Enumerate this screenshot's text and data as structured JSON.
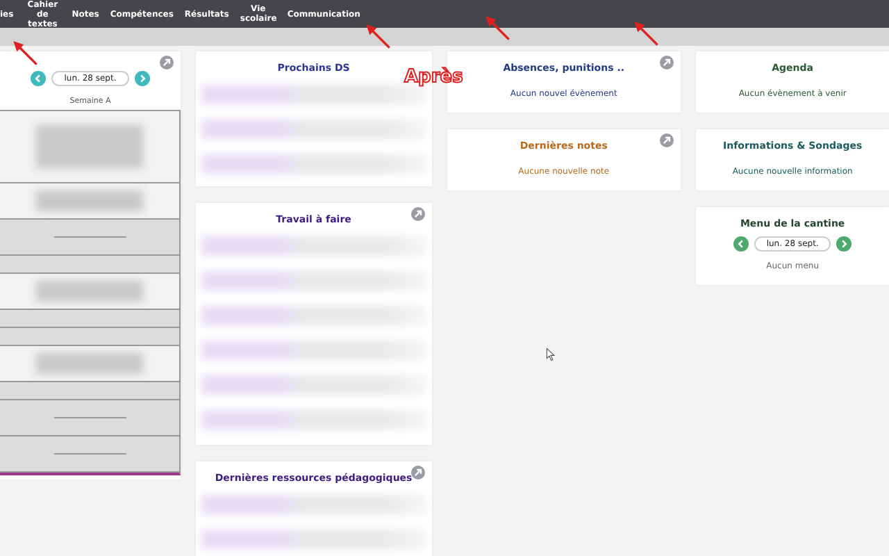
{
  "nav": {
    "items": [
      {
        "label": "ies"
      },
      {
        "label": "Cahier de textes"
      },
      {
        "label": "Notes"
      },
      {
        "label": "Compétences"
      },
      {
        "label": "Résultats"
      },
      {
        "label": "Vie scolaire"
      },
      {
        "label": "Communication"
      }
    ]
  },
  "annotation": {
    "text": "Après"
  },
  "timetable": {
    "date": "lun. 28 sept.",
    "week": "Semaine A",
    "expandable": true,
    "slots": [
      {
        "kind": "double"
      },
      {
        "kind": "lesson"
      },
      {
        "kind": "free"
      },
      {
        "kind": "gap"
      },
      {
        "kind": "lesson"
      },
      {
        "kind": "gap"
      },
      {
        "kind": "gap"
      },
      {
        "kind": "lesson"
      },
      {
        "kind": "gap"
      },
      {
        "kind": "free"
      },
      {
        "kind": "free"
      }
    ]
  },
  "columns": [
    [
      {
        "kind": "blurred",
        "title": "Prochains DS",
        "color": "#2b3593",
        "expandable": false
      },
      {
        "kind": "blurred",
        "title": "Travail à faire",
        "color": "#3b1c82",
        "expandable": true
      },
      {
        "kind": "blurred",
        "title": "Dernières ressources pédagogiques",
        "color": "#3b1c82",
        "expandable": true
      }
    ],
    [
      {
        "kind": "message",
        "title": "Absences, punitions ..",
        "color": "#233a84",
        "expandable": true,
        "message": "Aucun nouvel évènement"
      },
      {
        "kind": "message",
        "title": "Dernières notes",
        "color": "#b8681a",
        "expandable": true,
        "message": "Aucune nouvelle note"
      }
    ],
    [
      {
        "kind": "message",
        "title": "Agenda",
        "color": "#2a5a33",
        "expandable": false,
        "message": "Aucun évènement à venir"
      },
      {
        "kind": "message",
        "title": "Informations & Sondages",
        "color": "#1d5a5c",
        "expandable": false,
        "message": "Aucune nouvelle information"
      },
      {
        "kind": "menu",
        "title": "Menu de la cantine",
        "color": "#24452c",
        "expandable": false,
        "date": "lun. 28 sept.",
        "message": "Aucun menu"
      }
    ]
  ]
}
